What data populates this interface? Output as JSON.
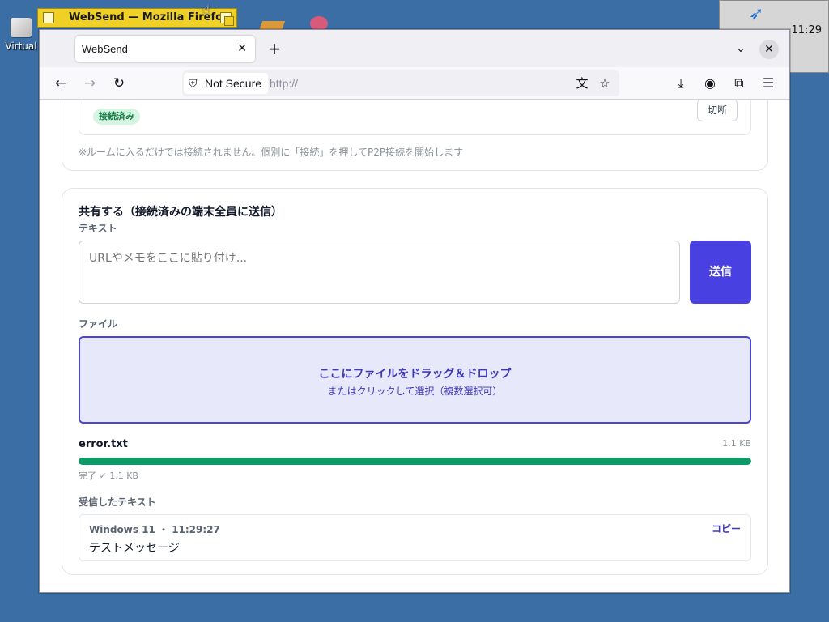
{
  "desktop": {
    "icon_label": "Virtual",
    "taskbar_title": "WebSend — Mozilla Firefox",
    "clock": "11:29"
  },
  "browser": {
    "tab_title": "WebSend",
    "security_label": "Not Secure",
    "url": "http://"
  },
  "peer_panel": {
    "status_badge": "接続済み",
    "disconnect_label": "切断",
    "note": "※ルームに入るだけでは接続されません。個別に「接続」を押してP2P接続を開始します"
  },
  "share": {
    "title": "共有する（接続済みの端末全員に送信）",
    "text_label": "テキスト",
    "text_placeholder": "URLやメモをここに貼り付け...",
    "send_label": "送信",
    "file_label": "ファイル",
    "dropzone_main": "ここにファイルをドラッグ＆ドロップ",
    "dropzone_sub": "またはクリックして選択（複数選択可）",
    "transfer": {
      "file_name": "error.txt",
      "file_size": "1.1 KB",
      "progress": 1.0,
      "status": "完了 ✓ 1.1 KB"
    },
    "received_label": "受信したテキスト",
    "received": {
      "meta": "Windows 11 ・ 11:29:27",
      "copy_label": "コピー",
      "text": "テストメッセージ"
    }
  },
  "colors": {
    "accent": "#4840e0",
    "success": "#0f9a67",
    "desktop": "#3a6ea5"
  }
}
